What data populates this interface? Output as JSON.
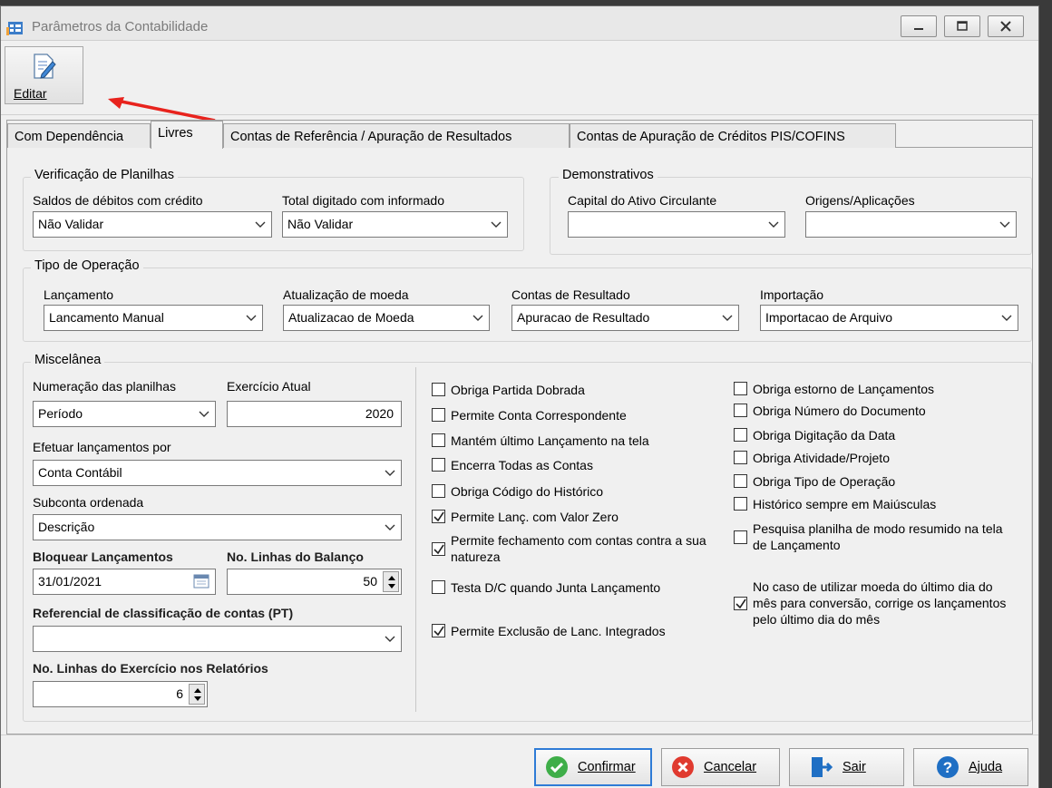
{
  "window": {
    "title": "Parâmetros da Contabilidade"
  },
  "toolbar": {
    "edit_label": "Editar"
  },
  "tabs": [
    {
      "label": "Com Dependência"
    },
    {
      "label": "Livres"
    },
    {
      "label": "Contas de Referência / Apuração de Resultados"
    },
    {
      "label": "Contas de Apuração de Créditos PIS/COFINS"
    }
  ],
  "verificacao": {
    "legend": "Verificação de Planilhas",
    "saldos_label": "Saldos de débitos com crédito",
    "saldos_value": "Não Validar",
    "total_label": "Total digitado com informado",
    "total_value": "Não Validar"
  },
  "demonstrativos": {
    "legend": "Demonstrativos",
    "capital_label": "Capital do Ativo Circulante",
    "capital_value": "",
    "origens_label": "Origens/Aplicações",
    "origens_value": ""
  },
  "tipo_operacao": {
    "legend": "Tipo de Operação",
    "lancamento_label": "Lançamento",
    "lancamento_value": "Lancamento Manual",
    "atualizacao_label": "Atualização de moeda",
    "atualizacao_value": "Atualizacao de Moeda",
    "contas_label": "Contas de Resultado",
    "contas_value": "Apuracao de Resultado",
    "importacao_label": "Importação",
    "importacao_value": "Importacao de Arquivo"
  },
  "miscelanea": {
    "legend": "Miscelânea",
    "numeracao_label": "Numeração das planilhas",
    "numeracao_value": "Período",
    "exercicio_label": "Exercício Atual",
    "exercicio_value": "2020",
    "efetuar_label": "Efetuar lançamentos por",
    "efetuar_value": "Conta Contábil",
    "subconta_label": "Subconta ordenada",
    "subconta_value": "Descrição",
    "bloquear_label": "Bloquear Lançamentos",
    "bloquear_value": "31/01/2021",
    "linhas_balanco_label": "No. Linhas do Balanço",
    "linhas_balanco_value": "50",
    "referencial_label": "Referencial de classificação de contas (PT)",
    "referencial_value": "",
    "linhas_exercicio_label": "No. Linhas do Exercício nos Relatórios",
    "linhas_exercicio_value": "6"
  },
  "checks_left": [
    {
      "label": "Obriga Partida Dobrada",
      "checked": false
    },
    {
      "label": "Permite Conta Correspondente",
      "checked": false
    },
    {
      "label": "Mantém último Lançamento na tela",
      "checked": false
    },
    {
      "label": "Encerra Todas as Contas",
      "checked": false
    },
    {
      "label": "Obriga Código do Histórico",
      "checked": false
    },
    {
      "label": "Permite Lanç. com Valor Zero",
      "checked": true
    },
    {
      "label": "Permite fechamento com contas contra a sua natureza",
      "checked": true
    },
    {
      "label": "Testa D/C quando Junta Lançamento",
      "checked": false
    },
    {
      "label": "Permite Exclusão de Lanc. Integrados",
      "checked": true
    }
  ],
  "checks_right": [
    {
      "label": "Obriga estorno de Lançamentos",
      "checked": false
    },
    {
      "label": "Obriga Número do Documento",
      "checked": false
    },
    {
      "label": "Obriga Digitação da Data",
      "checked": false
    },
    {
      "label": "Obriga Atividade/Projeto",
      "checked": false
    },
    {
      "label": "Obriga Tipo de Operação",
      "checked": false
    },
    {
      "label": "Histórico sempre em Maiúsculas",
      "checked": false
    },
    {
      "label": "Pesquisa planilha de modo resumido na tela de Lançamento",
      "checked": false
    },
    {
      "label": "No caso de utilizar moeda do último dia do mês para conversão, corrige os lançamentos pelo último dia do mês",
      "checked": true
    }
  ],
  "footer": {
    "confirm_label": "Confirmar",
    "cancel_label": "Cancelar",
    "exit_label": "Sair",
    "help_label": "Ajuda"
  },
  "colors": {
    "confirm_icon": "#3fae49",
    "cancel_icon": "#e03a2f",
    "exit_icon": "#1f6fc4",
    "help_icon": "#1f6fc4",
    "arrow": "#e8231d"
  }
}
